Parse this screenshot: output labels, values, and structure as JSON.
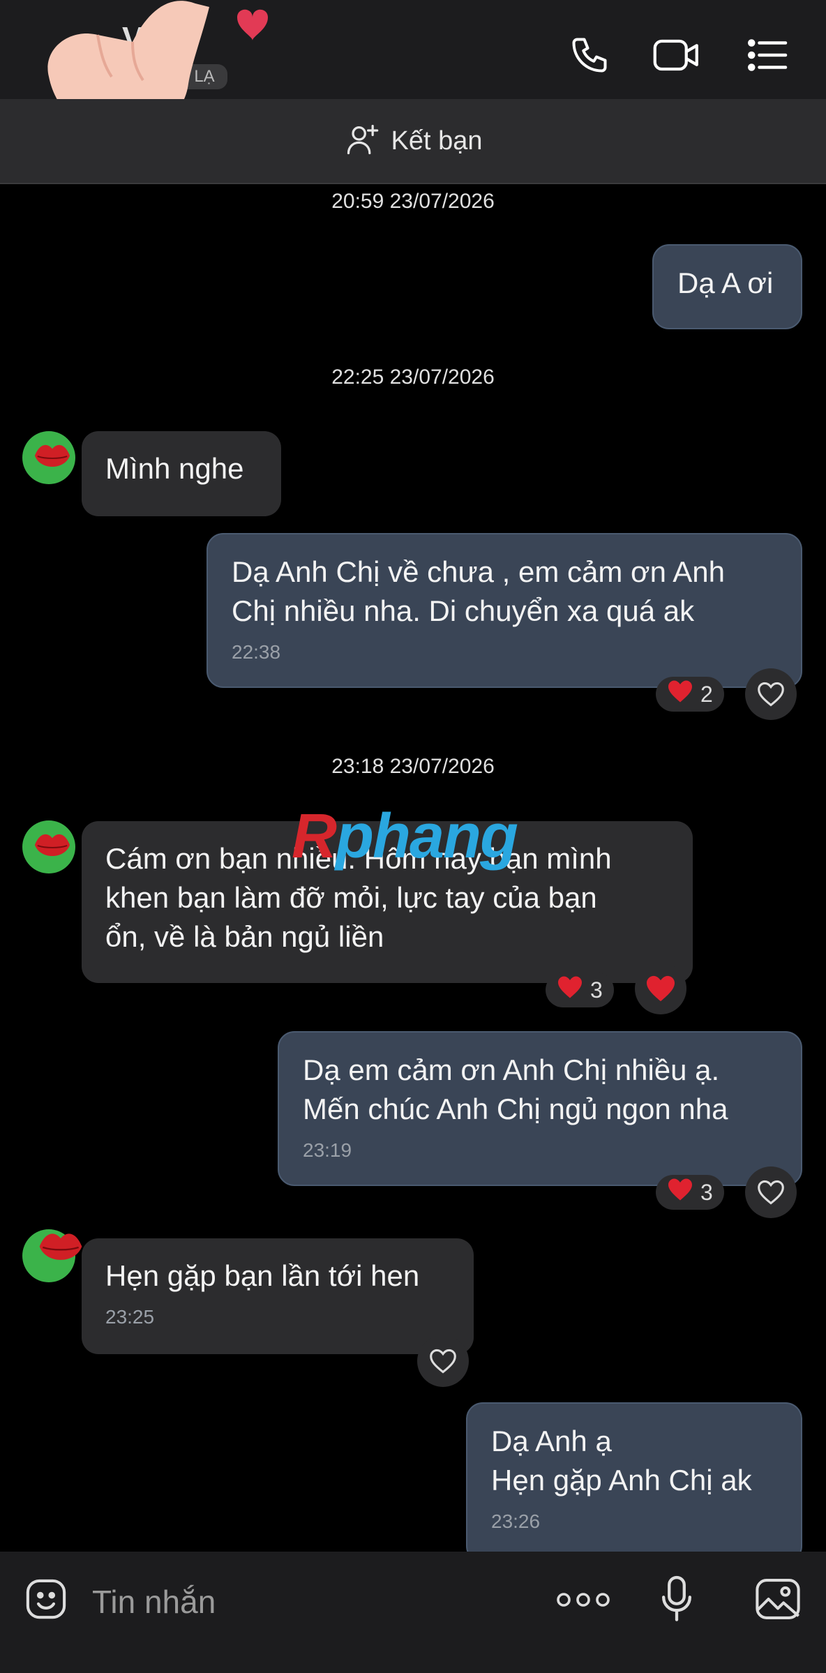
{
  "header": {
    "title": "V",
    "subtitle": "I LẠ",
    "icons": [
      "phone-icon",
      "video-call-icon",
      "menu-list-icon"
    ]
  },
  "friend_bar": {
    "label": "Kết bạn",
    "icon": "add-friend-icon"
  },
  "timestamps": [
    "20:59 23/07/2026",
    "22:25 23/07/2026",
    "23:18 23/07/2026"
  ],
  "messages": [
    {
      "dir": "out",
      "text": "Dạ A ơi"
    },
    {
      "dir": "in",
      "text": "Mình nghe"
    },
    {
      "dir": "out",
      "text": "Dạ Anh Chị về chưa , em cảm ơn Anh\nChị nhiều nha. Di chuyển xa quá ak",
      "time": "22:38",
      "reaction_count": "2"
    },
    {
      "dir": "in",
      "text": "Cám ơn bạn nhiều. Hôm nay bạn mình\nkhen bạn làm đỡ mỏi, lực tay của bạn\nổn, về là bản ngủ liền",
      "reaction_count": "3"
    },
    {
      "dir": "out",
      "text": "Dạ em cảm ơn Anh Chị nhiều ạ.\nMến chúc Anh Chị ngủ ngon nha",
      "time": "23:19",
      "reaction_count": "3"
    },
    {
      "dir": "in",
      "text": "Hẹn gặp bạn lần tới hen",
      "time": "23:25"
    },
    {
      "dir": "out",
      "text": "Dạ Anh ạ\nHẹn gặp Anh Chị ak",
      "time": "23:26"
    }
  ],
  "watermark": {
    "part1": "R",
    "part2": "phang"
  },
  "composer": {
    "placeholder": "Tin nhắn",
    "icons": [
      "emoji-icon",
      "more-dots-icon",
      "microphone-icon",
      "image-icon"
    ]
  },
  "colors": {
    "outgoing_bubble": "#3a4556",
    "incoming_bubble": "#2c2c2e",
    "avatar_bg": "#3bb34a",
    "heart": "#e0222f"
  }
}
